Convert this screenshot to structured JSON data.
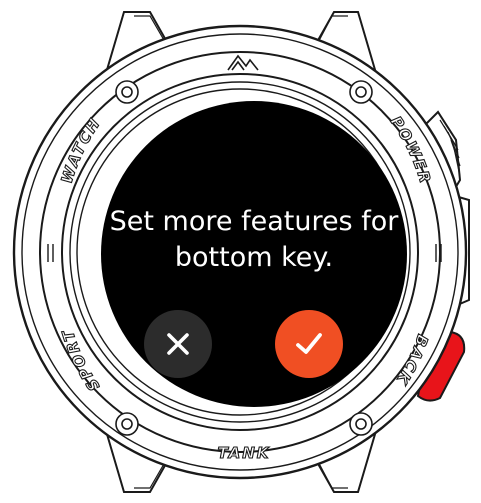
{
  "dialog": {
    "message": "Set more features for\nbottom key.",
    "cancel_icon": "close-icon",
    "confirm_icon": "check-icon",
    "confirm_color": "#f04f23",
    "cancel_color": "#2c2c2c"
  },
  "bezel": {
    "top_label": "TANK",
    "left_upper_label": "WATCH",
    "left_lower_label": "SPORT",
    "right_upper_label": "POWER",
    "right_lower_label": "BACK"
  },
  "colors": {
    "screen_background": "#000000",
    "back_button": "#e8141a",
    "case_outline": "#1a1a1a"
  }
}
